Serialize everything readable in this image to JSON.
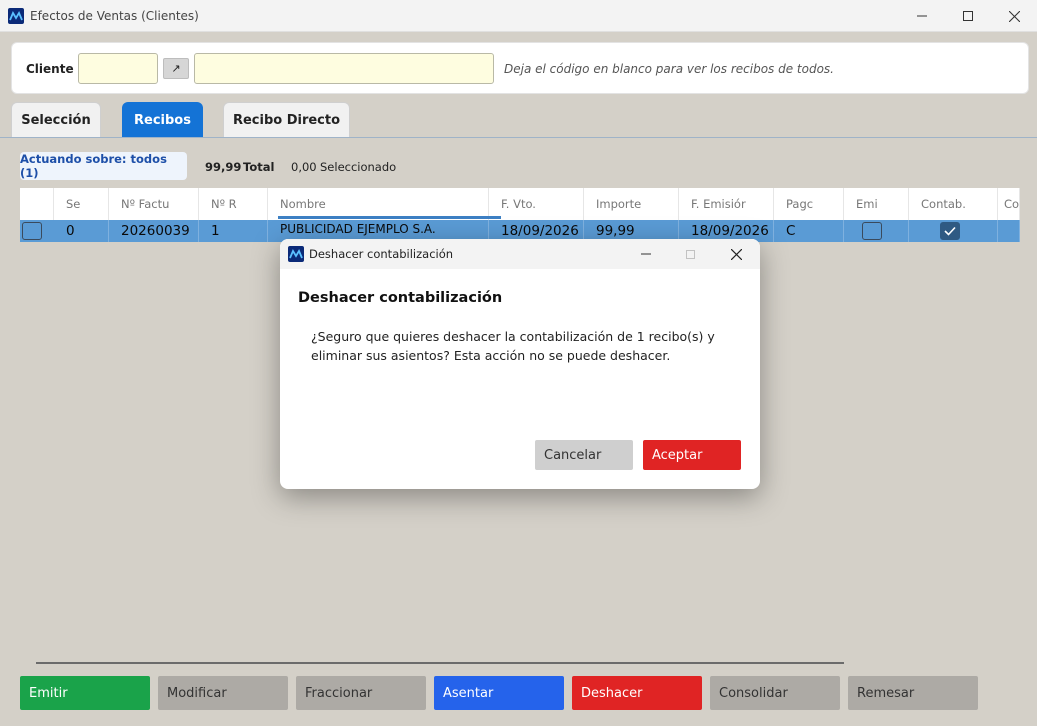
{
  "window": {
    "title": "Efectos de Ventas (Clientes)"
  },
  "client": {
    "label": "Cliente",
    "lookup_symbol": "↗",
    "hint": "Deja el código en blanco para ver los recibos de todos."
  },
  "tabs": [
    {
      "label": "Selección",
      "active": false
    },
    {
      "label": "Recibos",
      "active": true
    },
    {
      "label": "Recibo Directo",
      "active": false
    }
  ],
  "summary": {
    "scope": "Actuando sobre: todos (1)",
    "total_value": "99,99",
    "total_label": "Total",
    "selected_value": "0,00",
    "selected_label": "Seleccionado"
  },
  "grid": {
    "columns": [
      "Se",
      "Nº Factu",
      "Nº R",
      "Nombre",
      "F. Vto.",
      "Importe",
      "F. Emisiór",
      "Pagc",
      "Emi",
      "Contab.",
      "Co"
    ],
    "row": {
      "selected": false,
      "serie": "0",
      "factura": "20260039",
      "recibo": "1",
      "nombre": "PUBLICIDAD EJEMPLO S.A.",
      "vencimiento": "18/09/2026",
      "importe": "99,99",
      "emision": "18/09/2026",
      "pago": "C",
      "emitido": false,
      "contabilizado": true
    }
  },
  "actions": [
    "Emitir",
    "Modificar",
    "Fraccionar",
    "Asentar",
    "Deshacer",
    "Consolidar",
    "Remesar"
  ],
  "dialog": {
    "title": "Deshacer contabilización",
    "heading": "Deshacer contabilización",
    "message": "¿Seguro que quieres deshacer la contabilización de 1 recibo(s) y eliminar sus asientos? Esta acción no se puede deshacer.",
    "cancel": "Cancelar",
    "accept": "Aceptar"
  },
  "colors": {
    "accent": "#1473d6",
    "row_selected": "#5a9bd5",
    "success": "#1aa34a",
    "danger": "#e02424",
    "primary": "#2563eb",
    "input_bg": "#fefde0"
  }
}
